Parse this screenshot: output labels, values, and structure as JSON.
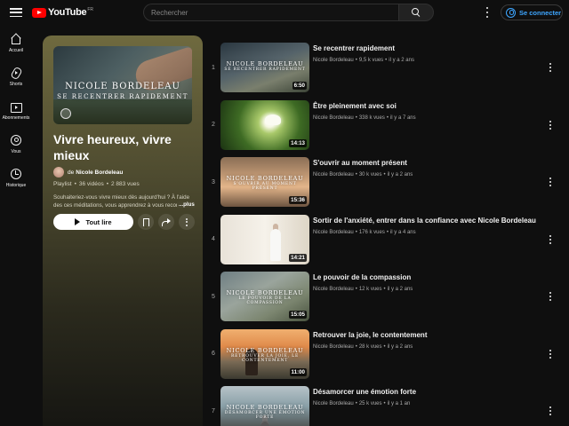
{
  "header": {
    "logo_text": "YouTube",
    "logo_country": "FR",
    "search_placeholder": "Rechercher",
    "signin_label": "Se connecter"
  },
  "sidebar": {
    "items": [
      {
        "label": "Accueil",
        "icon": "home-icon"
      },
      {
        "label": "Shorts",
        "icon": "shorts-icon"
      },
      {
        "label": "Abonnements",
        "icon": "subscriptions-icon"
      },
      {
        "label": "Vous",
        "icon": "you-icon"
      },
      {
        "label": "Historique",
        "icon": "history-icon"
      }
    ]
  },
  "playlist": {
    "thumb_line1": "NICOLE BORDELEAU",
    "thumb_line2": "SE RECENTRER RAPIDEMENT",
    "title": "Vivre heureux, vivre mieux",
    "author_prefix": "de",
    "author": "Nicole Bordeleau",
    "type": "Playlist",
    "video_count": "36 vidéos",
    "views": "2 883 vues",
    "description": "Souhaiteriez-vous vivre mieux dès aujourd'hui ? À l'aide des ces méditations, vous apprendrez à vous reconn",
    "more_label": "...plus",
    "play_all_label": "Tout lire"
  },
  "colors": {
    "panel_top": "#6f6a3f",
    "accent_link": "#3ea6ff",
    "brand_red": "#ff0000"
  },
  "videos": [
    {
      "index": "1",
      "title": "Se recentrer rapidement",
      "channel": "Nicole Bordeleau",
      "views": "9,5 k vues",
      "age": "il y a 2 ans",
      "duration": "6:50",
      "thumb_line1": "NICOLE BORDELEAU",
      "thumb_line2": "SE RECENTRER RAPIDEMENT"
    },
    {
      "index": "2",
      "title": "Être pleinement avec soi",
      "channel": "Nicole Bordeleau",
      "views": "338 k vues",
      "age": "il y a 7 ans",
      "duration": "14:13",
      "thumb_line1": "",
      "thumb_line2": ""
    },
    {
      "index": "3",
      "title": "S'ouvrir au moment présent",
      "channel": "Nicole Bordeleau",
      "views": "30 k vues",
      "age": "il y a 2 ans",
      "duration": "15:36",
      "thumb_line1": "NICOLE BORDELEAU",
      "thumb_line2": "S'OUVRIR AU MOMENT PRÉSENT"
    },
    {
      "index": "4",
      "title": "Sortir de l'anxiété, entrer dans la confiance avec Nicole Bordeleau",
      "channel": "Nicole Bordeleau",
      "views": "176 k vues",
      "age": "il y a 4 ans",
      "duration": "14:21",
      "thumb_line1": "",
      "thumb_line2": ""
    },
    {
      "index": "5",
      "title": "Le pouvoir de la compassion",
      "channel": "Nicole Bordeleau",
      "views": "12 k vues",
      "age": "il y a 2 ans",
      "duration": "15:05",
      "thumb_line1": "NICOLE BORDELEAU",
      "thumb_line2": "LE POUVOIR DE LA COMPASSION"
    },
    {
      "index": "6",
      "title": "Retrouver la joie, le contentement",
      "channel": "Nicole Bordeleau",
      "views": "28 k vues",
      "age": "il y a 2 ans",
      "duration": "11:00",
      "thumb_line1": "NICOLE BORDELEAU",
      "thumb_line2": "RETROUVER LA JOIE, LE CONTENTEMENT"
    },
    {
      "index": "7",
      "title": "Désamorcer une émotion forte",
      "channel": "Nicole Bordeleau",
      "views": "25 k vues",
      "age": "il y a 1 an",
      "duration": "",
      "thumb_line1": "NICOLE BORDELEAU",
      "thumb_line2": "DÉSAMORCER UNE ÉMOTION FORTE"
    }
  ]
}
